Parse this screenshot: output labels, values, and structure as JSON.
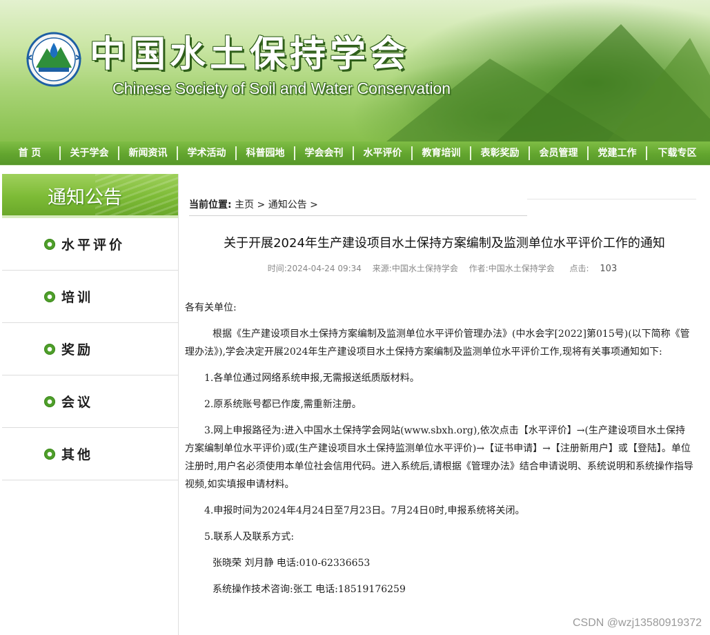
{
  "header": {
    "title": "中国水土保持学会",
    "subtitle": "Chinese Society of Soil and Water Conservation",
    "logo_icon": "society-emblem-icon"
  },
  "nav": {
    "items": [
      "首 页",
      "关于学会",
      "新闻资讯",
      "学术活动",
      "科普园地",
      "学会会刊",
      "水平评价",
      "教育培训",
      "表彰奖励",
      "会员管理",
      "党建工作",
      "下载专区"
    ]
  },
  "sidebar": {
    "title": "通知公告",
    "items": [
      "水平评价",
      "培训",
      "奖励",
      "会议",
      "其他"
    ]
  },
  "breadcrumb": {
    "label": "当前位置:",
    "home": "主页",
    "sep1": " > ",
    "current": "通知公告",
    "sep2": " >"
  },
  "article": {
    "title": "关于开展2024年生产建设项目水土保持方案编制及监测单位水平评价工作的通知",
    "meta": {
      "time": "时间:2024-04-24 09:34",
      "source": "来源:中国水土保持学会",
      "author": "作者:中国水土保持学会",
      "clicks_label": "点击:",
      "clicks": "103"
    },
    "greeting": "各有关单位:",
    "intro": "根据《生产建设项目水土保持方案编制及监测单位水平评价管理办法》(中水会字[2022]第015号)(以下简称《管理办法》),学会决定开展2024年生产建设项目水土保持方案编制及监测单位水平评价工作,现将有关事项通知如下:",
    "items": [
      "1.各单位通过网络系统申报,无需报送纸质版材料。",
      "2.原系统账号都已作废,需重新注册。",
      "3.网上申报路径为:进入中国水土保持学会网站(www.sbxh.org),依次点击【水平评价】→(生产建设项目水土保持方案编制单位水平评价)或(生产建设项目水土保持监测单位水平评价)→【证书申请】→【注册新用户】或【登陆】。单位注册时,用户名必须使用本单位社会信用代码。进入系统后,请根据《管理办法》结合申请说明、系统说明和系统操作指导视频,如实填报申请材料。",
      "4.申报时间为2024年4月24日至7月23日。7月24日0时,申报系统将关闭。",
      "5.联系人及联系方式:"
    ],
    "contact1": "张晓荣   刘月静   电话:010-62336653",
    "contact2": "系统操作技术咨询:张工   电话:18519176259"
  },
  "watermark": "CSDN @wzj13580919372",
  "colors": {
    "nav": "#62a52e",
    "sidebar_head": "#7dbb36",
    "accent": "#4e9e2a"
  }
}
